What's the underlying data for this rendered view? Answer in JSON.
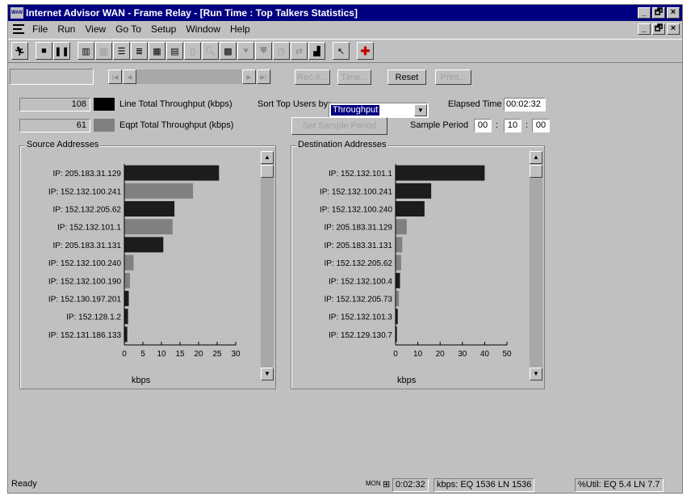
{
  "window": {
    "title": "Internet Advisor WAN - Frame Relay - [Run Time : Top Talkers Statistics]",
    "app_icon_text": "WAN",
    "controls": [
      "_",
      "🗗",
      "×"
    ]
  },
  "menu": {
    "items": [
      "File",
      "Run",
      "View",
      "Go To",
      "Setup",
      "Window",
      "Help"
    ],
    "mdi_controls": [
      "_",
      "🗗",
      "×"
    ]
  },
  "toolbar": {
    "icons": [
      "run-figure",
      "stop",
      "pause",
      "bar-chart",
      "bar-chart-disabled",
      "list-left",
      "list-detail",
      "grid",
      "grid-2",
      "page-disabled",
      "zoom-disabled",
      "picture",
      "heart-disabled",
      "shield-disabled",
      "clock-disabled",
      "swap-disabled",
      "histogram",
      "arrow-cursor",
      "red-cross"
    ]
  },
  "navigation": {
    "rec_label": "Rec #...",
    "time_label": "Time...",
    "reset_label": "Reset",
    "print_label": "Print..."
  },
  "summary": {
    "line_value": "108",
    "line_label": "Line Total Throughput (kbps)",
    "eqpt_value": "61",
    "eqpt_label": "Eqpt Total Throughput (kbps)",
    "line_color": "#000000",
    "eqpt_color": "#808080",
    "sort_label": "Sort Top Users by:",
    "sort_value": "Throughput",
    "elapsed_label": "Elapsed Time",
    "elapsed_value": "00:02:32",
    "set_sample_label": "Set Sample Period",
    "sample_label": "Sample Period",
    "sample_h": "00",
    "sample_m": "10",
    "sample_s": "00"
  },
  "source": {
    "title": "Source Addresses",
    "xlabel": "kbps"
  },
  "destination": {
    "title": "Destination Addresses",
    "xlabel": "kbps"
  },
  "chart_data": [
    {
      "type": "bar",
      "orientation": "horizontal",
      "title": "Source Addresses",
      "xlabel": "kbps",
      "xlim": [
        0,
        30
      ],
      "ticks": [
        0,
        5,
        10,
        15,
        20,
        25,
        30
      ],
      "categories": [
        "IP: 205.183.31.129",
        "IP: 152.132.100.241",
        "IP: 152.132.205.62",
        "IP: 152.132.101.1",
        "IP: 205.183.31.131",
        "IP: 152.132.100.240",
        "IP: 152.132.100.190",
        "IP: 152.130.197.201",
        "IP: 152.128.1.2",
        "IP: 152.131.186.133"
      ],
      "values": [
        25.5,
        18.5,
        13.5,
        13,
        10.5,
        2.5,
        1.5,
        1.2,
        1.0,
        0.8
      ],
      "colors": [
        "#1c1c1c",
        "#808080",
        "#1c1c1c",
        "#808080",
        "#1c1c1c",
        "#808080",
        "#808080",
        "#1c1c1c",
        "#1c1c1c",
        "#1c1c1c"
      ]
    },
    {
      "type": "bar",
      "orientation": "horizontal",
      "title": "Destination Addresses",
      "xlabel": "kbps",
      "xlim": [
        0,
        50
      ],
      "ticks": [
        0,
        10,
        20,
        30,
        40,
        50
      ],
      "categories": [
        "IP: 152.132.101.1",
        "IP: 152.132.100.241",
        "IP: 152.132.100.240",
        "IP: 205.183.31.129",
        "IP: 205.183.31.131",
        "IP: 152.132.205.62",
        "IP: 152.132.100.4",
        "IP: 152.132.205.73",
        "IP: 152.132.101.3",
        "IP: 152.129.130.7"
      ],
      "values": [
        40,
        16,
        13,
        5,
        3,
        2.5,
        2,
        1.5,
        1,
        0.6
      ],
      "colors": [
        "#1c1c1c",
        "#1c1c1c",
        "#1c1c1c",
        "#808080",
        "#808080",
        "#808080",
        "#1c1c1c",
        "#808080",
        "#1c1c1c",
        "#1c1c1c"
      ]
    }
  ],
  "status": {
    "ready": "Ready",
    "mon": "MON",
    "time": "0:02:32",
    "kbps": "kbps: EQ 1536  LN 1536",
    "util": "%Util: EQ 5.4  LN 7.7"
  }
}
